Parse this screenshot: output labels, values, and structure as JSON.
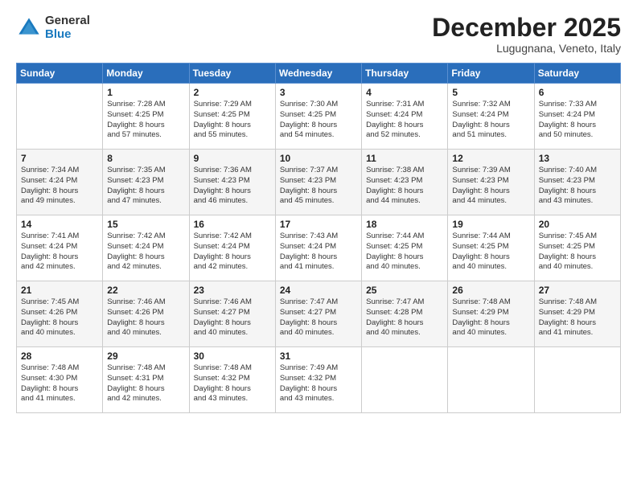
{
  "logo": {
    "general": "General",
    "blue": "Blue"
  },
  "header": {
    "month": "December 2025",
    "location": "Lugugnana, Veneto, Italy"
  },
  "days_of_week": [
    "Sunday",
    "Monday",
    "Tuesday",
    "Wednesday",
    "Thursday",
    "Friday",
    "Saturday"
  ],
  "weeks": [
    [
      {
        "day": "",
        "detail": ""
      },
      {
        "day": "1",
        "detail": "Sunrise: 7:28 AM\nSunset: 4:25 PM\nDaylight: 8 hours\nand 57 minutes."
      },
      {
        "day": "2",
        "detail": "Sunrise: 7:29 AM\nSunset: 4:25 PM\nDaylight: 8 hours\nand 55 minutes."
      },
      {
        "day": "3",
        "detail": "Sunrise: 7:30 AM\nSunset: 4:25 PM\nDaylight: 8 hours\nand 54 minutes."
      },
      {
        "day": "4",
        "detail": "Sunrise: 7:31 AM\nSunset: 4:24 PM\nDaylight: 8 hours\nand 52 minutes."
      },
      {
        "day": "5",
        "detail": "Sunrise: 7:32 AM\nSunset: 4:24 PM\nDaylight: 8 hours\nand 51 minutes."
      },
      {
        "day": "6",
        "detail": "Sunrise: 7:33 AM\nSunset: 4:24 PM\nDaylight: 8 hours\nand 50 minutes."
      }
    ],
    [
      {
        "day": "7",
        "detail": "Sunrise: 7:34 AM\nSunset: 4:24 PM\nDaylight: 8 hours\nand 49 minutes."
      },
      {
        "day": "8",
        "detail": "Sunrise: 7:35 AM\nSunset: 4:23 PM\nDaylight: 8 hours\nand 47 minutes."
      },
      {
        "day": "9",
        "detail": "Sunrise: 7:36 AM\nSunset: 4:23 PM\nDaylight: 8 hours\nand 46 minutes."
      },
      {
        "day": "10",
        "detail": "Sunrise: 7:37 AM\nSunset: 4:23 PM\nDaylight: 8 hours\nand 45 minutes."
      },
      {
        "day": "11",
        "detail": "Sunrise: 7:38 AM\nSunset: 4:23 PM\nDaylight: 8 hours\nand 44 minutes."
      },
      {
        "day": "12",
        "detail": "Sunrise: 7:39 AM\nSunset: 4:23 PM\nDaylight: 8 hours\nand 44 minutes."
      },
      {
        "day": "13",
        "detail": "Sunrise: 7:40 AM\nSunset: 4:23 PM\nDaylight: 8 hours\nand 43 minutes."
      }
    ],
    [
      {
        "day": "14",
        "detail": "Sunrise: 7:41 AM\nSunset: 4:24 PM\nDaylight: 8 hours\nand 42 minutes."
      },
      {
        "day": "15",
        "detail": "Sunrise: 7:42 AM\nSunset: 4:24 PM\nDaylight: 8 hours\nand 42 minutes."
      },
      {
        "day": "16",
        "detail": "Sunrise: 7:42 AM\nSunset: 4:24 PM\nDaylight: 8 hours\nand 42 minutes."
      },
      {
        "day": "17",
        "detail": "Sunrise: 7:43 AM\nSunset: 4:24 PM\nDaylight: 8 hours\nand 41 minutes."
      },
      {
        "day": "18",
        "detail": "Sunrise: 7:44 AM\nSunset: 4:25 PM\nDaylight: 8 hours\nand 40 minutes."
      },
      {
        "day": "19",
        "detail": "Sunrise: 7:44 AM\nSunset: 4:25 PM\nDaylight: 8 hours\nand 40 minutes."
      },
      {
        "day": "20",
        "detail": "Sunrise: 7:45 AM\nSunset: 4:25 PM\nDaylight: 8 hours\nand 40 minutes."
      }
    ],
    [
      {
        "day": "21",
        "detail": "Sunrise: 7:45 AM\nSunset: 4:26 PM\nDaylight: 8 hours\nand 40 minutes."
      },
      {
        "day": "22",
        "detail": "Sunrise: 7:46 AM\nSunset: 4:26 PM\nDaylight: 8 hours\nand 40 minutes."
      },
      {
        "day": "23",
        "detail": "Sunrise: 7:46 AM\nSunset: 4:27 PM\nDaylight: 8 hours\nand 40 minutes."
      },
      {
        "day": "24",
        "detail": "Sunrise: 7:47 AM\nSunset: 4:27 PM\nDaylight: 8 hours\nand 40 minutes."
      },
      {
        "day": "25",
        "detail": "Sunrise: 7:47 AM\nSunset: 4:28 PM\nDaylight: 8 hours\nand 40 minutes."
      },
      {
        "day": "26",
        "detail": "Sunrise: 7:48 AM\nSunset: 4:29 PM\nDaylight: 8 hours\nand 40 minutes."
      },
      {
        "day": "27",
        "detail": "Sunrise: 7:48 AM\nSunset: 4:29 PM\nDaylight: 8 hours\nand 41 minutes."
      }
    ],
    [
      {
        "day": "28",
        "detail": "Sunrise: 7:48 AM\nSunset: 4:30 PM\nDaylight: 8 hours\nand 41 minutes."
      },
      {
        "day": "29",
        "detail": "Sunrise: 7:48 AM\nSunset: 4:31 PM\nDaylight: 8 hours\nand 42 minutes."
      },
      {
        "day": "30",
        "detail": "Sunrise: 7:48 AM\nSunset: 4:32 PM\nDaylight: 8 hours\nand 43 minutes."
      },
      {
        "day": "31",
        "detail": "Sunrise: 7:49 AM\nSunset: 4:32 PM\nDaylight: 8 hours\nand 43 minutes."
      },
      {
        "day": "",
        "detail": ""
      },
      {
        "day": "",
        "detail": ""
      },
      {
        "day": "",
        "detail": ""
      }
    ]
  ]
}
